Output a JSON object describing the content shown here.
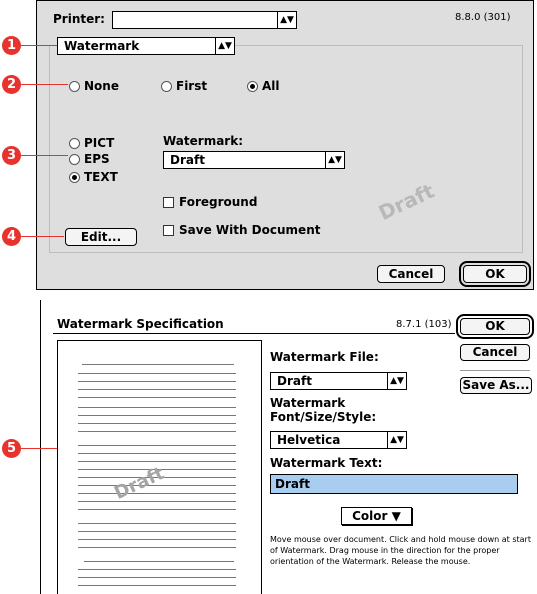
{
  "dialog1": {
    "printer_label": "Printer:",
    "printer_value": "",
    "version": "8.8.0 (301)",
    "section_popup": "Watermark",
    "radio_none": "None",
    "radio_first": "First",
    "radio_all": "All",
    "radio_pict": "PICT",
    "radio_eps": "EPS",
    "radio_text": "TEXT",
    "watermark_label": "Watermark:",
    "watermark_value": "Draft",
    "foreground_label": "Foreground",
    "save_with_document_label": "Save With Document",
    "preview_text": "Draft",
    "edit_button": "Edit...",
    "cancel_button": "Cancel",
    "ok_button": "OK"
  },
  "dialog2": {
    "title": "Watermark Specification",
    "version": "8.7.1 (103)",
    "ok_button": "OK",
    "cancel_button": "Cancel",
    "save_as_button": "Save As...",
    "file_label": "Watermark File:",
    "file_value": "Draft",
    "font_label_line1": "Watermark",
    "font_label_line2": "Font/Size/Style:",
    "font_value": "Helvetica",
    "text_label": "Watermark Text:",
    "text_value": "Draft",
    "color_button": "Color",
    "preview_text": "Draft",
    "instructions": "Move mouse over document. Click and hold mouse down at start of Watermark. Drag mouse in the direction for the proper orientation of the Watermark. Release the mouse."
  },
  "callouts": [
    "1",
    "2",
    "3",
    "4",
    "5"
  ],
  "colors": {
    "callout": "#e8322d",
    "text_field_bg": "#a9cdee"
  }
}
